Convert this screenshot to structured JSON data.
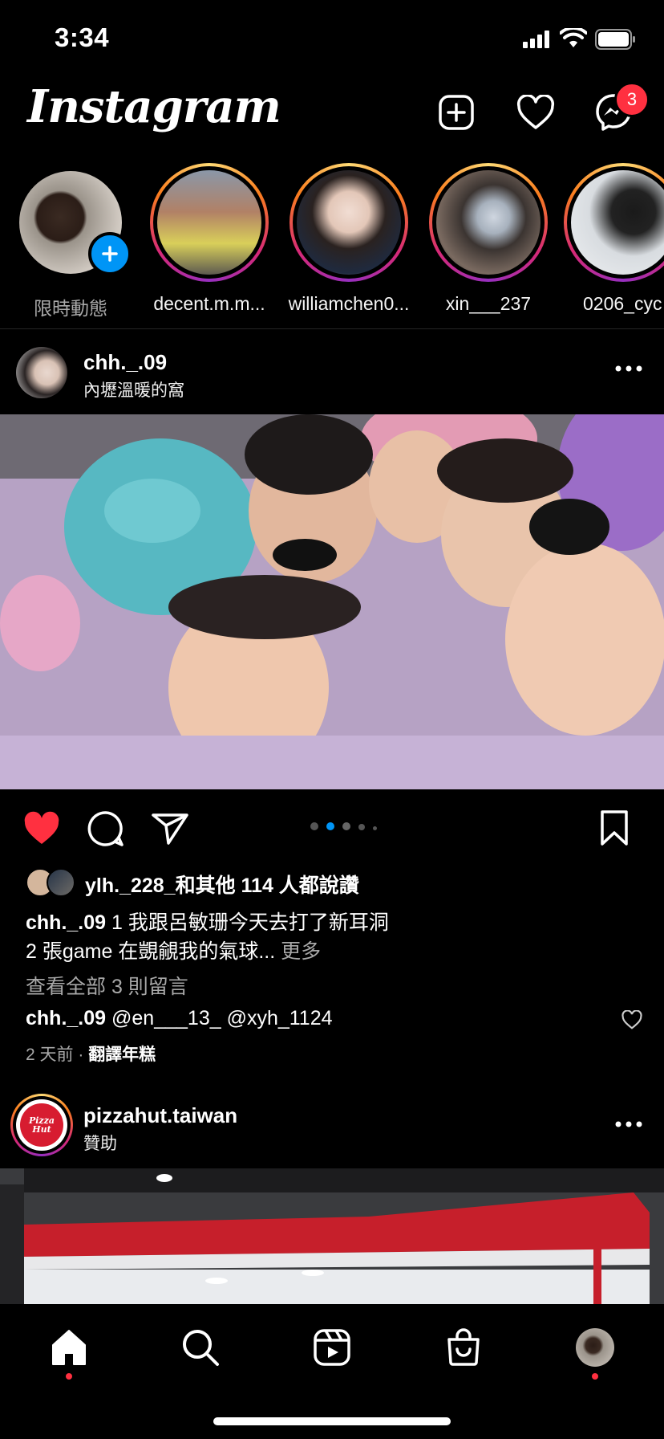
{
  "status": {
    "time": "3:34"
  },
  "header": {
    "logo": "Instagram",
    "messenger_badge": "3"
  },
  "stories": [
    {
      "label": "限時動態",
      "own": true
    },
    {
      "label": "decent.m.m..."
    },
    {
      "label": "williamchen0..."
    },
    {
      "label": "xin___237"
    },
    {
      "label": "0206_cyc"
    }
  ],
  "post1": {
    "username": "chh._.09",
    "location": "內壢溫暖的窩",
    "likes_text": "ylh._228_和其他 114 人都說讚",
    "caption_user": "chh._.09",
    "caption_line1": "1 我跟呂敏珊今天去打了新耳洞",
    "caption_line2": "2 張game 在覬覦我的氣球...",
    "more": "更多",
    "view_comments": "查看全部 3 則留言",
    "comment_user": "chh._.09",
    "comment_text": "@en___13_ @xyh_1124",
    "time_ago": "2 天前",
    "translate": "翻譯年糕",
    "carousel_count": 5,
    "carousel_active": 2
  },
  "post2": {
    "username": "pizzahut.taiwan",
    "sponsored": "贊助",
    "logo_text": "Pizza Hut"
  },
  "colors": {
    "like_red": "#ff3040",
    "carousel_blue": "#0095f6"
  }
}
